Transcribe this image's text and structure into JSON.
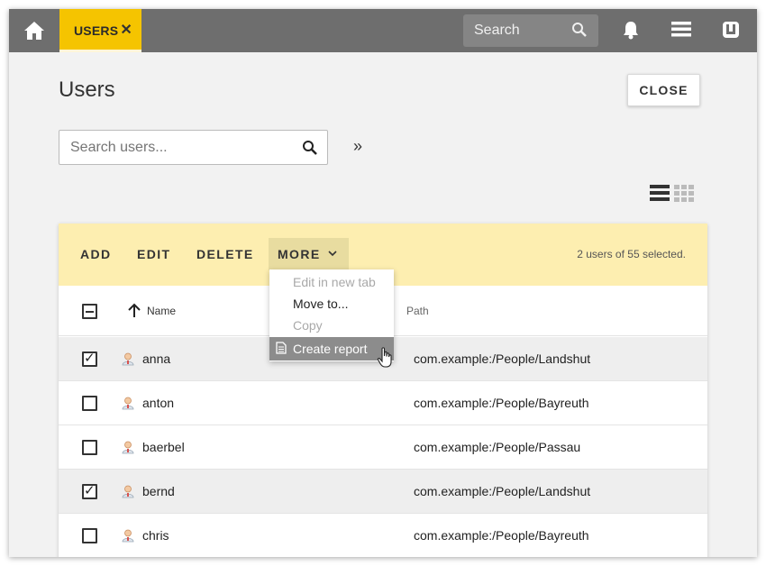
{
  "topbar": {
    "home_icon": "home-icon",
    "tab_label": "USERS",
    "tab_close": "✕",
    "search_placeholder": "Search",
    "search_icon": "search-icon",
    "bell_icon": "bell-icon",
    "menu_icon": "menu-icon",
    "logo_icon": "app-logo-icon"
  },
  "page": {
    "title": "Users",
    "close_label": "CLOSE",
    "search_placeholder": "Search users...",
    "expand_label": "»"
  },
  "toolbar": {
    "add_label": "ADD",
    "edit_label": "EDIT",
    "delete_label": "DELETE",
    "more_label": "MORE",
    "selection_info": "2 users of 55 selected."
  },
  "more_menu": {
    "items": [
      {
        "label": "Edit in new tab",
        "state": "disabled"
      },
      {
        "label": "Move to...",
        "state": "enabled"
      },
      {
        "label": "Copy",
        "state": "disabled"
      },
      {
        "label": "Create report",
        "state": "hover",
        "icon": "document-icon"
      }
    ]
  },
  "table": {
    "columns": {
      "name": "Name",
      "path": "Path"
    },
    "header_checkbox_state": "indeterminate",
    "sort": "ascending",
    "rows": [
      {
        "name": "anna",
        "path": "com.example:/People/Landshut",
        "selected": true
      },
      {
        "name": "anton",
        "path": "com.example:/People/Bayreuth",
        "selected": false
      },
      {
        "name": "baerbel",
        "path": "com.example:/People/Passau",
        "selected": false
      },
      {
        "name": "bernd",
        "path": "com.example:/People/Landshut",
        "selected": true
      },
      {
        "name": "chris",
        "path": "com.example:/People/Bayreuth",
        "selected": false
      }
    ]
  },
  "colors": {
    "topbar_bg": "#6e6e6e",
    "accent": "#f5c400",
    "toolbar_bg": "#fdeeb0",
    "menu_hover": "#8c8c8c"
  }
}
